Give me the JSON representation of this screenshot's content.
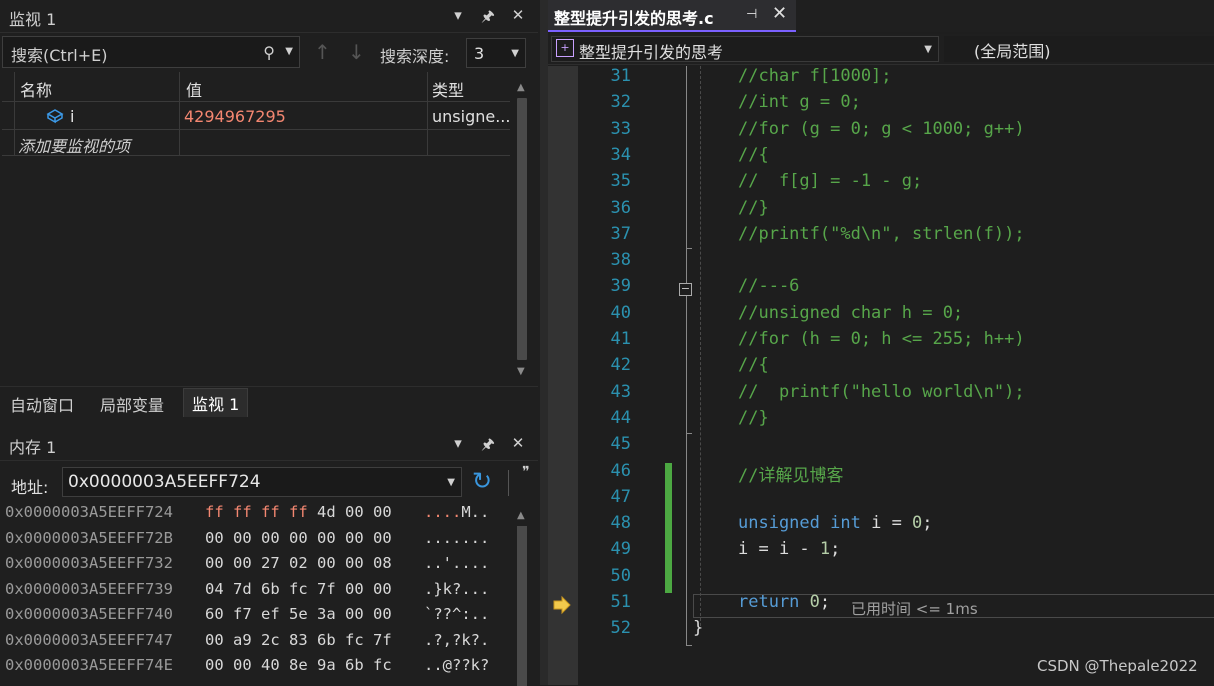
{
  "watch": {
    "title": "监视 1",
    "search_placeholder": "搜索(Ctrl+E)",
    "depth_label": "搜索深度:",
    "depth_value": "3",
    "columns": [
      "名称",
      "值",
      "类型"
    ],
    "rows": [
      {
        "name": "i",
        "value": "4294967295",
        "type": "unsigne..."
      }
    ],
    "add_item": "添加要监视的项"
  },
  "bottom_tabs": [
    "自动窗口",
    "局部变量",
    "监视 1"
  ],
  "memory": {
    "title": "内存 1",
    "address_label": "地址:",
    "address_value": "0x0000003A5EEFF724",
    "rows": [
      {
        "addr": "0x0000003A5EEFF724",
        "bytes": "ff ff ff ff 4d 00 00",
        "chars": "....M..",
        "changed": 4
      },
      {
        "addr": "0x0000003A5EEFF72B",
        "bytes": "00 00 00 00 00 00 00",
        "chars": ".......",
        "changed": 0
      },
      {
        "addr": "0x0000003A5EEFF732",
        "bytes": "00 00 27 02 00 00 08",
        "chars": "..'....",
        "changed": 0
      },
      {
        "addr": "0x0000003A5EEFF739",
        "bytes": "04 7d 6b fc 7f 00 00",
        "chars": ".}k?...",
        "changed": 0
      },
      {
        "addr": "0x0000003A5EEFF740",
        "bytes": "60 f7 ef 5e 3a 00 00",
        "chars": "`??^:..",
        "changed": 0
      },
      {
        "addr": "0x0000003A5EEFF747",
        "bytes": "00 a9 2c 83 6b fc 7f",
        "chars": ".?,?k?.",
        "changed": 0
      },
      {
        "addr": "0x0000003A5EEFF74E",
        "bytes": "00 00 40 8e 9a 6b fc",
        "chars": "..@??k?",
        "changed": 0
      }
    ]
  },
  "editor": {
    "file_tab": "整型提升引发的思考.c",
    "nav_scope": "整型提升引发的思考",
    "nav_global": "(全局范围)",
    "lines": [
      {
        "n": "31",
        "tokens": [
          {
            "c": "cm",
            "t": "//char f[1000];"
          }
        ]
      },
      {
        "n": "32",
        "tokens": [
          {
            "c": "cm",
            "t": "//int g = 0;"
          }
        ]
      },
      {
        "n": "33",
        "tokens": [
          {
            "c": "cm",
            "t": "//for (g = 0; g < 1000; g++)"
          }
        ]
      },
      {
        "n": "34",
        "tokens": [
          {
            "c": "cm",
            "t": "//{"
          }
        ]
      },
      {
        "n": "35",
        "tokens": [
          {
            "c": "cm",
            "t": "//  f[g] = -1 - g;"
          }
        ]
      },
      {
        "n": "36",
        "tokens": [
          {
            "c": "cm",
            "t": "//}"
          }
        ]
      },
      {
        "n": "37",
        "tokens": [
          {
            "c": "cm",
            "t": "//printf(\"%d\\n\", strlen(f));"
          }
        ]
      },
      {
        "n": "38",
        "tokens": []
      },
      {
        "n": "39",
        "tokens": [
          {
            "c": "cm",
            "t": "//---6"
          }
        ]
      },
      {
        "n": "40",
        "tokens": [
          {
            "c": "cm",
            "t": "//unsigned char h = 0;"
          }
        ]
      },
      {
        "n": "41",
        "tokens": [
          {
            "c": "cm",
            "t": "//for (h = 0; h <= 255; h++)"
          }
        ]
      },
      {
        "n": "42",
        "tokens": [
          {
            "c": "cm",
            "t": "//{"
          }
        ]
      },
      {
        "n": "43",
        "tokens": [
          {
            "c": "cm",
            "t": "//  printf(\"hello world\\n\");"
          }
        ]
      },
      {
        "n": "44",
        "tokens": [
          {
            "c": "cm",
            "t": "//}"
          }
        ]
      },
      {
        "n": "45",
        "tokens": []
      },
      {
        "n": "46",
        "tokens": [
          {
            "c": "cm",
            "t": "//详解见博客"
          }
        ]
      },
      {
        "n": "47",
        "tokens": []
      },
      {
        "n": "48",
        "tokens": [
          {
            "c": "kw",
            "t": "unsigned"
          },
          {
            "c": "tx",
            "t": " "
          },
          {
            "c": "kw",
            "t": "int"
          },
          {
            "c": "tx",
            "t": " i = "
          },
          {
            "c": "nm",
            "t": "0"
          },
          {
            "c": "tx",
            "t": ";"
          }
        ]
      },
      {
        "n": "49",
        "tokens": [
          {
            "c": "tx",
            "t": "i = i - "
          },
          {
            "c": "nm",
            "t": "1"
          },
          {
            "c": "tx",
            "t": ";"
          }
        ]
      },
      {
        "n": "50",
        "tokens": []
      },
      {
        "n": "51",
        "tokens": [
          {
            "c": "kw",
            "t": "return"
          },
          {
            "c": "tx",
            "t": " "
          },
          {
            "c": "nm",
            "t": "0"
          },
          {
            "c": "tx",
            "t": ";"
          }
        ]
      },
      {
        "n": "52",
        "tokens": [
          {
            "c": "tx",
            "t": "}"
          }
        ],
        "indent": "brace"
      }
    ],
    "elapsed": "已用时间 <= 1ms"
  },
  "watermark": "CSDN @Thepale2022",
  "colors": {
    "changed_value": "#f48771",
    "comment": "#57a64a",
    "keyword": "#569cd6",
    "number": "#b5cea8",
    "line_number": "#2b91af",
    "accent": "#7b61ff"
  }
}
